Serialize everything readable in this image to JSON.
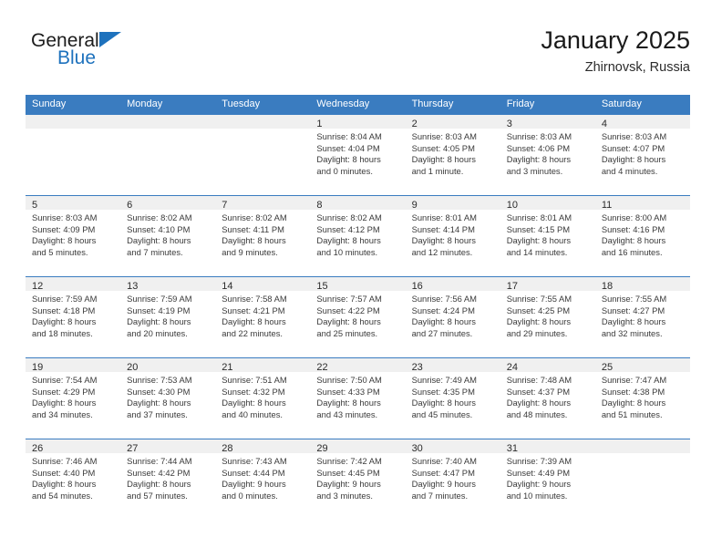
{
  "brand": {
    "name_part1": "General",
    "name_part2": "Blue",
    "triangle_icon": "triangle-icon",
    "accent_color": "#1e72bd"
  },
  "header": {
    "title": "January 2025",
    "subtitle": "Zhirnovsk, Russia"
  },
  "calendar": {
    "header_bg": "#3a7cc0",
    "daynum_bg": "#f0f0f0",
    "weekdays": [
      "Sunday",
      "Monday",
      "Tuesday",
      "Wednesday",
      "Thursday",
      "Friday",
      "Saturday"
    ],
    "weeks": [
      [
        {
          "day": "",
          "sunrise": "",
          "sunset": "",
          "daylight1": "",
          "daylight2": ""
        },
        {
          "day": "",
          "sunrise": "",
          "sunset": "",
          "daylight1": "",
          "daylight2": ""
        },
        {
          "day": "",
          "sunrise": "",
          "sunset": "",
          "daylight1": "",
          "daylight2": ""
        },
        {
          "day": "1",
          "sunrise": "Sunrise: 8:04 AM",
          "sunset": "Sunset: 4:04 PM",
          "daylight1": "Daylight: 8 hours",
          "daylight2": "and 0 minutes."
        },
        {
          "day": "2",
          "sunrise": "Sunrise: 8:03 AM",
          "sunset": "Sunset: 4:05 PM",
          "daylight1": "Daylight: 8 hours",
          "daylight2": "and 1 minute."
        },
        {
          "day": "3",
          "sunrise": "Sunrise: 8:03 AM",
          "sunset": "Sunset: 4:06 PM",
          "daylight1": "Daylight: 8 hours",
          "daylight2": "and 3 minutes."
        },
        {
          "day": "4",
          "sunrise": "Sunrise: 8:03 AM",
          "sunset": "Sunset: 4:07 PM",
          "daylight1": "Daylight: 8 hours",
          "daylight2": "and 4 minutes."
        }
      ],
      [
        {
          "day": "5",
          "sunrise": "Sunrise: 8:03 AM",
          "sunset": "Sunset: 4:09 PM",
          "daylight1": "Daylight: 8 hours",
          "daylight2": "and 5 minutes."
        },
        {
          "day": "6",
          "sunrise": "Sunrise: 8:02 AM",
          "sunset": "Sunset: 4:10 PM",
          "daylight1": "Daylight: 8 hours",
          "daylight2": "and 7 minutes."
        },
        {
          "day": "7",
          "sunrise": "Sunrise: 8:02 AM",
          "sunset": "Sunset: 4:11 PM",
          "daylight1": "Daylight: 8 hours",
          "daylight2": "and 9 minutes."
        },
        {
          "day": "8",
          "sunrise": "Sunrise: 8:02 AM",
          "sunset": "Sunset: 4:12 PM",
          "daylight1": "Daylight: 8 hours",
          "daylight2": "and 10 minutes."
        },
        {
          "day": "9",
          "sunrise": "Sunrise: 8:01 AM",
          "sunset": "Sunset: 4:14 PM",
          "daylight1": "Daylight: 8 hours",
          "daylight2": "and 12 minutes."
        },
        {
          "day": "10",
          "sunrise": "Sunrise: 8:01 AM",
          "sunset": "Sunset: 4:15 PM",
          "daylight1": "Daylight: 8 hours",
          "daylight2": "and 14 minutes."
        },
        {
          "day": "11",
          "sunrise": "Sunrise: 8:00 AM",
          "sunset": "Sunset: 4:16 PM",
          "daylight1": "Daylight: 8 hours",
          "daylight2": "and 16 minutes."
        }
      ],
      [
        {
          "day": "12",
          "sunrise": "Sunrise: 7:59 AM",
          "sunset": "Sunset: 4:18 PM",
          "daylight1": "Daylight: 8 hours",
          "daylight2": "and 18 minutes."
        },
        {
          "day": "13",
          "sunrise": "Sunrise: 7:59 AM",
          "sunset": "Sunset: 4:19 PM",
          "daylight1": "Daylight: 8 hours",
          "daylight2": "and 20 minutes."
        },
        {
          "day": "14",
          "sunrise": "Sunrise: 7:58 AM",
          "sunset": "Sunset: 4:21 PM",
          "daylight1": "Daylight: 8 hours",
          "daylight2": "and 22 minutes."
        },
        {
          "day": "15",
          "sunrise": "Sunrise: 7:57 AM",
          "sunset": "Sunset: 4:22 PM",
          "daylight1": "Daylight: 8 hours",
          "daylight2": "and 25 minutes."
        },
        {
          "day": "16",
          "sunrise": "Sunrise: 7:56 AM",
          "sunset": "Sunset: 4:24 PM",
          "daylight1": "Daylight: 8 hours",
          "daylight2": "and 27 minutes."
        },
        {
          "day": "17",
          "sunrise": "Sunrise: 7:55 AM",
          "sunset": "Sunset: 4:25 PM",
          "daylight1": "Daylight: 8 hours",
          "daylight2": "and 29 minutes."
        },
        {
          "day": "18",
          "sunrise": "Sunrise: 7:55 AM",
          "sunset": "Sunset: 4:27 PM",
          "daylight1": "Daylight: 8 hours",
          "daylight2": "and 32 minutes."
        }
      ],
      [
        {
          "day": "19",
          "sunrise": "Sunrise: 7:54 AM",
          "sunset": "Sunset: 4:29 PM",
          "daylight1": "Daylight: 8 hours",
          "daylight2": "and 34 minutes."
        },
        {
          "day": "20",
          "sunrise": "Sunrise: 7:53 AM",
          "sunset": "Sunset: 4:30 PM",
          "daylight1": "Daylight: 8 hours",
          "daylight2": "and 37 minutes."
        },
        {
          "day": "21",
          "sunrise": "Sunrise: 7:51 AM",
          "sunset": "Sunset: 4:32 PM",
          "daylight1": "Daylight: 8 hours",
          "daylight2": "and 40 minutes."
        },
        {
          "day": "22",
          "sunrise": "Sunrise: 7:50 AM",
          "sunset": "Sunset: 4:33 PM",
          "daylight1": "Daylight: 8 hours",
          "daylight2": "and 43 minutes."
        },
        {
          "day": "23",
          "sunrise": "Sunrise: 7:49 AM",
          "sunset": "Sunset: 4:35 PM",
          "daylight1": "Daylight: 8 hours",
          "daylight2": "and 45 minutes."
        },
        {
          "day": "24",
          "sunrise": "Sunrise: 7:48 AM",
          "sunset": "Sunset: 4:37 PM",
          "daylight1": "Daylight: 8 hours",
          "daylight2": "and 48 minutes."
        },
        {
          "day": "25",
          "sunrise": "Sunrise: 7:47 AM",
          "sunset": "Sunset: 4:38 PM",
          "daylight1": "Daylight: 8 hours",
          "daylight2": "and 51 minutes."
        }
      ],
      [
        {
          "day": "26",
          "sunrise": "Sunrise: 7:46 AM",
          "sunset": "Sunset: 4:40 PM",
          "daylight1": "Daylight: 8 hours",
          "daylight2": "and 54 minutes."
        },
        {
          "day": "27",
          "sunrise": "Sunrise: 7:44 AM",
          "sunset": "Sunset: 4:42 PM",
          "daylight1": "Daylight: 8 hours",
          "daylight2": "and 57 minutes."
        },
        {
          "day": "28",
          "sunrise": "Sunrise: 7:43 AM",
          "sunset": "Sunset: 4:44 PM",
          "daylight1": "Daylight: 9 hours",
          "daylight2": "and 0 minutes."
        },
        {
          "day": "29",
          "sunrise": "Sunrise: 7:42 AM",
          "sunset": "Sunset: 4:45 PM",
          "daylight1": "Daylight: 9 hours",
          "daylight2": "and 3 minutes."
        },
        {
          "day": "30",
          "sunrise": "Sunrise: 7:40 AM",
          "sunset": "Sunset: 4:47 PM",
          "daylight1": "Daylight: 9 hours",
          "daylight2": "and 7 minutes."
        },
        {
          "day": "31",
          "sunrise": "Sunrise: 7:39 AM",
          "sunset": "Sunset: 4:49 PM",
          "daylight1": "Daylight: 9 hours",
          "daylight2": "and 10 minutes."
        },
        {
          "day": "",
          "sunrise": "",
          "sunset": "",
          "daylight1": "",
          "daylight2": ""
        }
      ]
    ]
  }
}
